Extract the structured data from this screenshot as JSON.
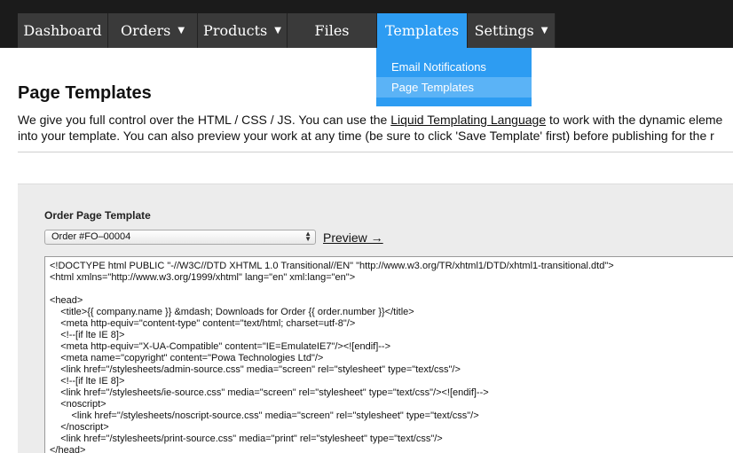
{
  "nav": {
    "items": [
      {
        "label": "Dashboard",
        "has_caret": false,
        "active": false
      },
      {
        "label": "Orders",
        "has_caret": true,
        "active": false
      },
      {
        "label": "Products",
        "has_caret": true,
        "active": false
      },
      {
        "label": "Files",
        "has_caret": false,
        "active": false
      },
      {
        "label": "Templates",
        "has_caret": false,
        "active": true
      },
      {
        "label": "Settings",
        "has_caret": true,
        "active": false
      }
    ],
    "caret_glyph": "▼"
  },
  "dropdown": {
    "items": [
      {
        "label": "Email Notifications",
        "hover": false
      },
      {
        "label": "Page Templates",
        "hover": true
      }
    ]
  },
  "page": {
    "title": "Page Templates",
    "desc_line1_before": "We give you full control over the HTML / CSS / JS. You can use the ",
    "desc_link": "Liquid Templating Language",
    "desc_line1_after": " to work with the dynamic eleme",
    "desc_line2": "into your template. You can also preview your work at any time (be sure to click 'Save Template' first) before publishing for the r"
  },
  "panel": {
    "label": "Order Page Template",
    "select_value": "Order #FO–00004",
    "preview_label": "Preview →",
    "code_lines": [
      "<!DOCTYPE html PUBLIC \"-//W3C//DTD XHTML 1.0 Transitional//EN\" \"http://www.w3.org/TR/xhtml1/DTD/xhtml1-transitional.dtd\">",
      "<html xmlns=\"http://www.w3.org/1999/xhtml\" lang=\"en\" xml:lang=\"en\">",
      "",
      "<head>",
      "    <title>{{ company.name }} &mdash; Downloads for Order {{ order.number }}</title>",
      "    <meta http-equiv=\"content-type\" content=\"text/html; charset=utf-8\"/>",
      "    <!--[if lte IE 8]>",
      "    <meta http-equiv=\"X-UA-Compatible\" content=\"IE=EmulateIE7\"/><![endif]-->",
      "    <meta name=\"copyright\" content=\"Powa Technologies Ltd\"/>",
      "    <link href=\"/stylesheets/admin-source.css\" media=\"screen\" rel=\"stylesheet\" type=\"text/css\"/>",
      "    <!--[if lte IE 8]>",
      "    <link href=\"/stylesheets/ie-source.css\" media=\"screen\" rel=\"stylesheet\" type=\"text/css\"/><![endif]-->",
      "    <noscript>",
      "        <link href=\"/stylesheets/noscript-source.css\" media=\"screen\" rel=\"stylesheet\" type=\"text/css\"/>",
      "    </noscript>",
      "    <link href=\"/stylesheets/print-source.css\" media=\"print\" rel=\"stylesheet\" type=\"text/css\"/>",
      "</head>"
    ]
  },
  "colors": {
    "topbar": "#1b1b1b",
    "nav_item": "#3a3a3a",
    "accent": "#2d9cf2",
    "dropdown_hover": "#5bb3f6",
    "panel": "#ececec"
  }
}
